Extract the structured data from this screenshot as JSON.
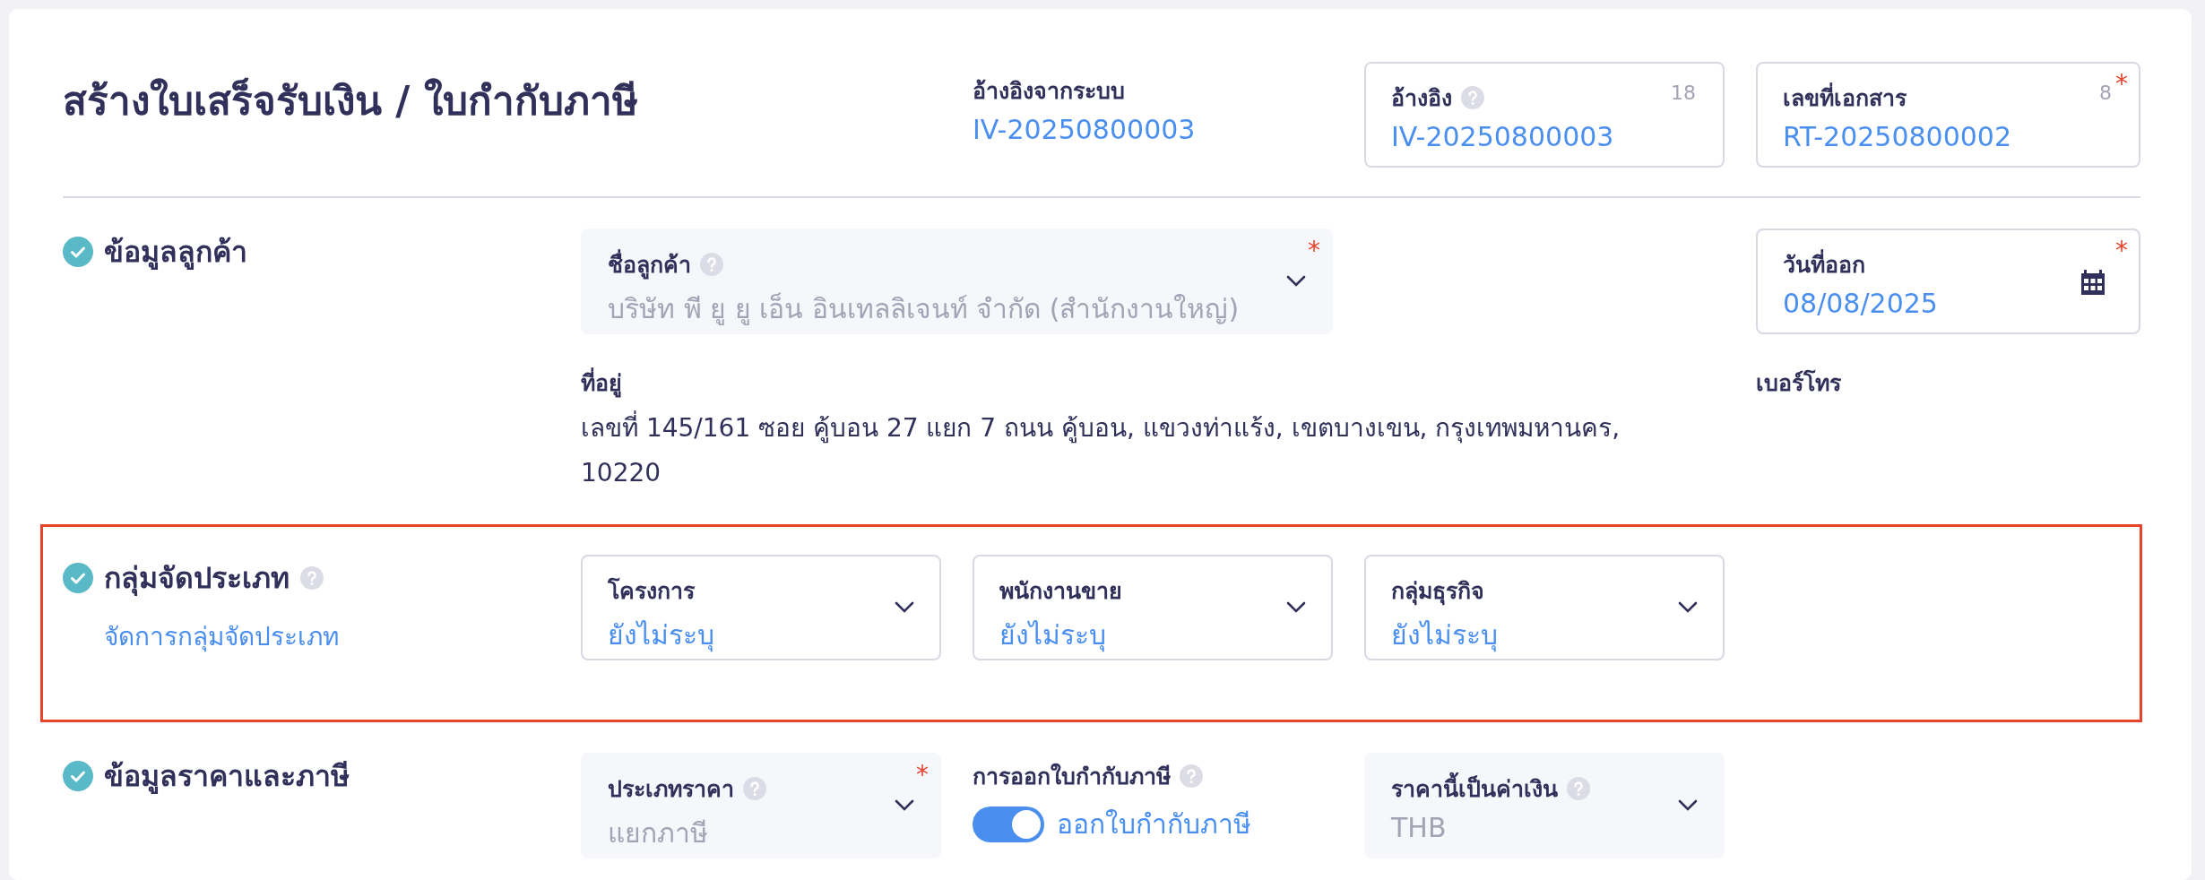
{
  "title": "สร้างใบเสร็จรับเงิน / ใบกำกับภาษี",
  "header_fields": [
    {
      "kind": "plain",
      "label": "อ้างอิงจากระบบ",
      "value": "IV-20250800003"
    },
    {
      "kind": "box",
      "label": "อ้างอิง",
      "help": true,
      "counter": "18",
      "value": "IV-20250800003"
    },
    {
      "kind": "box",
      "label": "เลขที่เอกสาร",
      "help": false,
      "counter": "8",
      "required_mark": "*",
      "value": "RT-20250800002"
    }
  ],
  "sections": [
    {
      "title": "ข้อมูลลูกค้า",
      "complete": true,
      "help": false,
      "highlighted": false,
      "fields": [
        {
          "kind": "select",
          "label": "ชื่อลูกค้า",
          "help": true,
          "required_mark": "*",
          "disabled": true,
          "value": "บริษัท พี ยู ยู เอ็น อินเทลลิเจนท์ จำกัด (สำนักงานใหญ่)"
        },
        {
          "kind": "date",
          "label": "วันที่ออก",
          "required_mark": "*",
          "value": "08/08/2025"
        },
        {
          "kind": "text",
          "label": "ที่อยู่",
          "value": "เลขที่ 145/161 ซอย คู้บอน 27 แยก 7 ถนน คู้บอน, แขวงท่าแร้ง, เขตบางเขน, กรุงเทพมหานคร, 10220"
        },
        {
          "kind": "text",
          "label": "เบอร์โทร"
        }
      ]
    },
    {
      "title": "กลุ่มจัดประเภท",
      "complete": true,
      "help": true,
      "highlighted": true,
      "link": "จัดการกลุ่มจัดประเภท",
      "fields": [
        {
          "kind": "select",
          "label": "โครงการ",
          "help": false,
          "disabled": false,
          "value": "ยังไม่ระบุ"
        },
        {
          "kind": "select",
          "label": "พนักงานขาย",
          "help": false,
          "disabled": false,
          "value": "ยังไม่ระบุ"
        },
        {
          "kind": "select",
          "label": "กลุ่มธุรกิจ",
          "help": false,
          "disabled": false,
          "value": "ยังไม่ระบุ"
        }
      ]
    },
    {
      "title": "ข้อมูลราคาและภาษี",
      "complete": true,
      "help": false,
      "highlighted": false,
      "fields": [
        {
          "kind": "select",
          "label": "ประเภทราคา",
          "help": true,
          "required_mark": "*",
          "disabled": true,
          "value": "แยกภาษี"
        },
        {
          "kind": "toggle",
          "label": "การออกใบกำกับภาษี",
          "help": true,
          "on": true,
          "value": "ออกใบกำกับภาษี"
        },
        {
          "kind": "select",
          "label": "ราคานี้เป็นค่าเงิน",
          "help": true,
          "disabled": true,
          "value": "THB"
        }
      ]
    }
  ]
}
